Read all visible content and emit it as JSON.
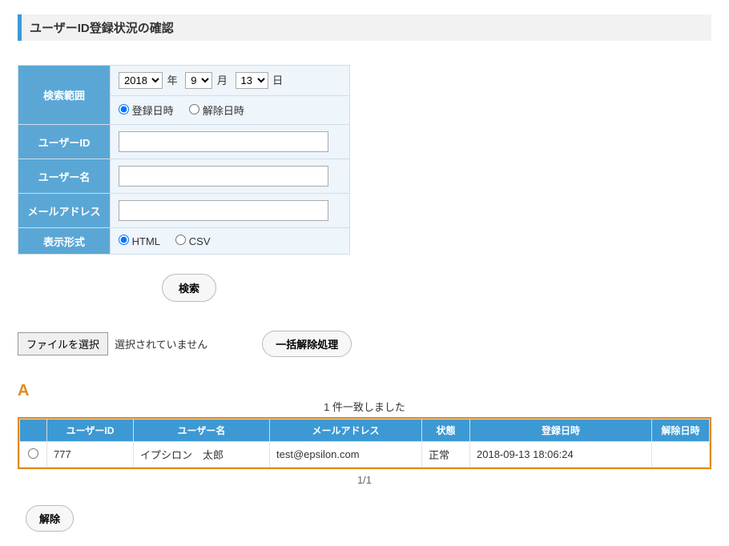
{
  "title": "ユーザーID登録状況の確認",
  "search": {
    "range_label": "検索範囲",
    "year": "2018",
    "year_unit": "年",
    "month": "9",
    "month_unit": "月",
    "day": "13",
    "day_unit": "日",
    "date_type_registered": "登録日時",
    "date_type_released": "解除日時",
    "userid_label": "ユーザーID",
    "userid_value": "",
    "username_label": "ユーザー名",
    "username_value": "",
    "email_label": "メールアドレス",
    "email_value": "",
    "format_label": "表示形式",
    "format_html": "HTML",
    "format_csv": "CSV"
  },
  "buttons": {
    "search": "検索",
    "file_choose": "ファイルを選択",
    "file_status": "選択されていません",
    "bulk_release": "一括解除処理",
    "release": "解除"
  },
  "annotation": {
    "letter": "A"
  },
  "results": {
    "match_text": "1 件一致しました",
    "columns": {
      "userid": "ユーザーID",
      "username": "ユーザー名",
      "email": "メールアドレス",
      "status": "状態",
      "registered": "登録日時",
      "released": "解除日時"
    },
    "rows": [
      {
        "userid": "777",
        "username": "イプシロン　太郎",
        "email": "test@epsilon.com",
        "status": "正常",
        "registered": "2018-09-13 18:06:24",
        "released": ""
      }
    ],
    "pager": "1/1"
  }
}
